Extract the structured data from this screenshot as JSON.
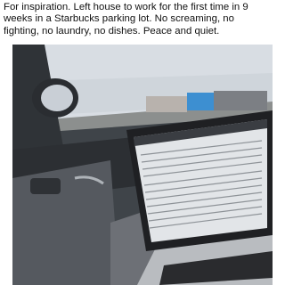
{
  "post": {
    "caption": "For inspiration. Left house to work for the first time in 9 weeks in a Starbucks parking lot. No screaming, no fighting, no laundry, no dishes. Peace and quiet."
  },
  "photo": {
    "scene": "car-interior-laptop",
    "colors": {
      "sky": "#d9dee4",
      "interior": "#4a4f55",
      "laptop": "#2b2c2f",
      "screen": "#dfe3e7",
      "accent_building": "#3d8fd1"
    }
  }
}
